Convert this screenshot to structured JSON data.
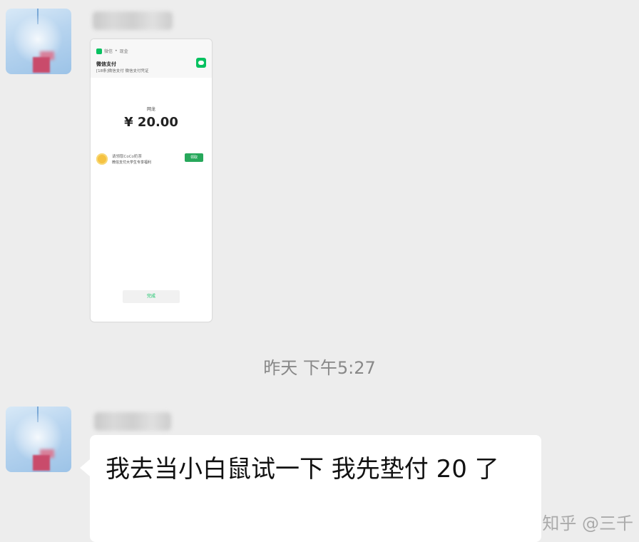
{
  "messages": [
    {
      "id": "image-message",
      "attachment": {
        "app_label": "微信",
        "source_label": "现金",
        "title": "微信支付",
        "subtitle": "[18条]微信支付 微信支付凭证",
        "payee": "网龙",
        "amount": "¥ 20.00",
        "promo_name": "请领取CoCo奶茶",
        "promo_desc": "微信支付大学生专享福利",
        "promo_button": "领取",
        "done_button": "完成"
      }
    }
  ],
  "timestamp": "昨天 下午5:27",
  "text_message": "我去当小白鼠试一下  我先垫付 20 了",
  "watermark": "知乎 @三千"
}
